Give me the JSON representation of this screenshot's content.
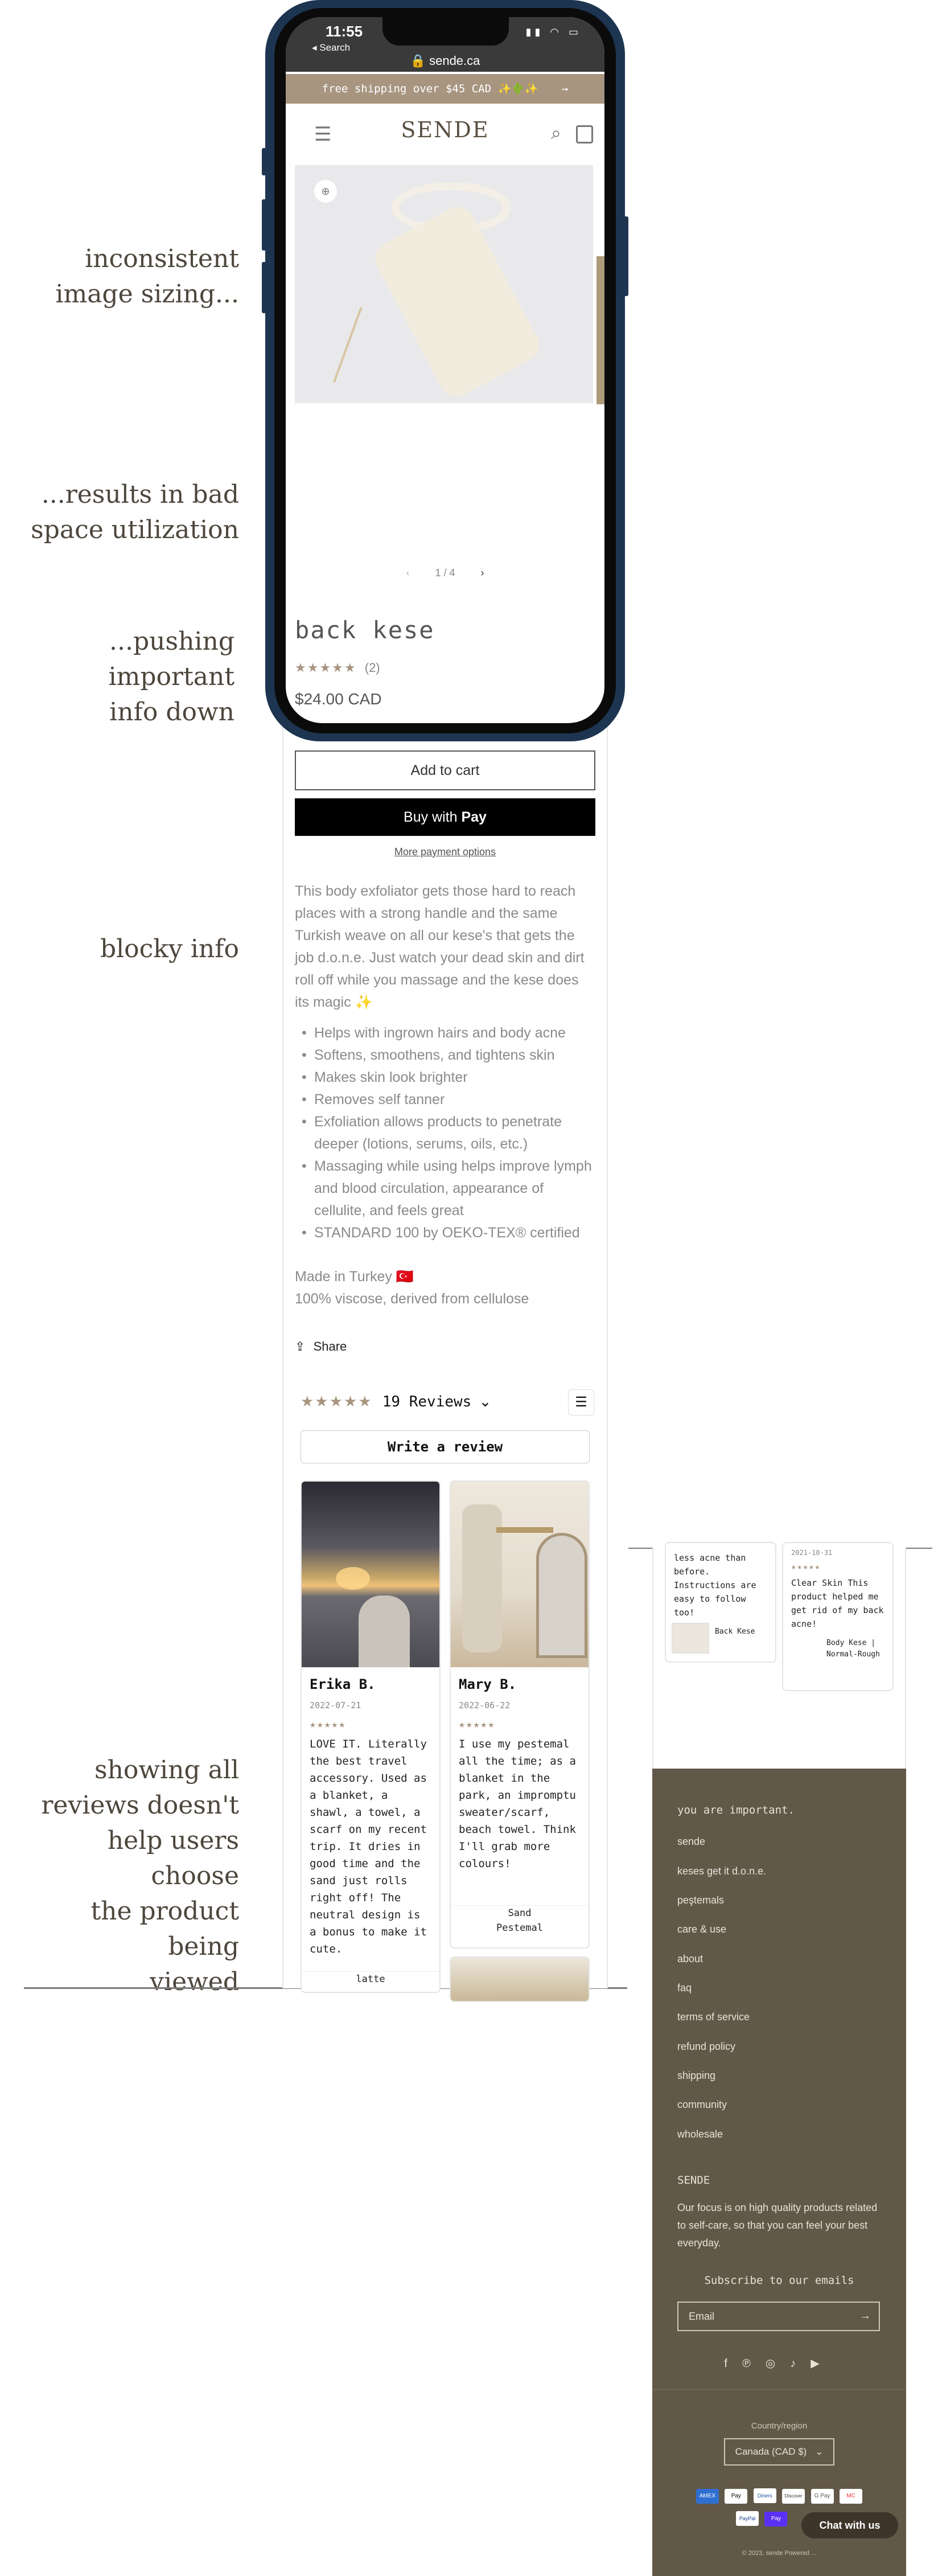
{
  "annotations": {
    "image_sizing": [
      "inconsistent",
      "image sizing..."
    ],
    "space_utilization": [
      "...results in bad",
      "space utilization"
    ],
    "pushing_info": [
      "...pushing important",
      "info down"
    ],
    "blocky_info": "blocky info",
    "showing_reviews": [
      "showing all",
      "reviews doesn't",
      "help users choose",
      "the product being",
      "viewed"
    ]
  },
  "status_bar": {
    "time": "11:55",
    "back_label": "◂ Search",
    "url": "🔒 sende.ca"
  },
  "announcement": "free shipping over $45 CAD ✨🌵✨",
  "header": {
    "logo": "SENDE"
  },
  "gallery": {
    "counter": "1 / 4"
  },
  "product": {
    "title": "back kese",
    "rating_count": "(2)",
    "price": "$24.00 CAD",
    "add_to_cart": "Add to cart",
    "buy_with": "Buy with",
    "pay_label": "Pay",
    "more_payment": "More payment options",
    "description": "This body exfoliator gets those hard to reach places with a strong handle and the same Turkish weave on all our kese's that gets the job d.o.n.e. Just watch your dead skin and dirt roll off while you massage and the kese does its magic ✨",
    "bullets": [
      "Helps with ingrown hairs and body acne",
      "Softens, smoothens, and tightens skin",
      "Makes skin look brighter",
      "Removes self tanner",
      "Exfoliation allows products to penetrate deeper (lotions, serums, oils, etc.)",
      "Massaging while using helps improve lymph and blood circulation, appearance of cellulite, and feels great",
      "STANDARD 100 by OEKO-TEX® certified"
    ],
    "made_in": "Made in Turkey 🇹🇷",
    "material": "100% viscose, derived from cellulose",
    "share": "Share"
  },
  "reviews": {
    "summary": "19 Reviews",
    "write_review": "Write a review",
    "cards": [
      {
        "name": "Erika B.",
        "date": "2022-07-21",
        "text": "LOVE IT. Literally the best travel accessory. Used as a blanket, a shawl, a towel, a scarf on my recent trip. It dries in good time and the sand just rolls right off! The neutral design is a bonus to make it cute.",
        "product": "latte"
      },
      {
        "name": "Mary B.",
        "date": "2022-06-22",
        "text": "I use my pestemal all the time; as a blanket in the park, an impromptu sweater/scarf, beach towel. Think I'll grab more colours!",
        "product": "Sand Pestemal"
      }
    ]
  },
  "cropped_reviews": {
    "left_text": "less acne than before. Instructions are easy to follow too!",
    "left_product": "Back Kese",
    "right_date": "2021-10-31",
    "right_text": "Clear Skin This product helped me get rid of my back acne!",
    "right_product": "Body Kese | Normal-Rough"
  },
  "footer": {
    "tagline": "you are important.",
    "links": [
      "sende",
      "keses get it d.o.n.e.",
      "peştemals",
      "care & use",
      "about",
      "faq",
      "terms of service",
      "refund policy",
      "shipping",
      "community",
      "wholesale"
    ],
    "brand_heading": "SENDE",
    "brand_text": "Our focus is on high quality products related to self-care, so that you can feel your best everyday.",
    "subscribe_heading": "Subscribe to our emails",
    "email_placeholder": "Email",
    "country_label": "Country/region",
    "country_value": "Canada (CAD $)",
    "payment_methods": [
      "AMEX",
      "Pay",
      "Diners",
      "Discover",
      "G Pay",
      "MC",
      "PayPal",
      "Pay"
    ],
    "chat": "Chat with us",
    "copyright": "© 2023, sende Powered ..."
  },
  "colors": {
    "accent_tan": "#a79580",
    "footer_brown": "#625848",
    "phone_frame": "#1d3551",
    "annotation_text": "#4d463c"
  }
}
